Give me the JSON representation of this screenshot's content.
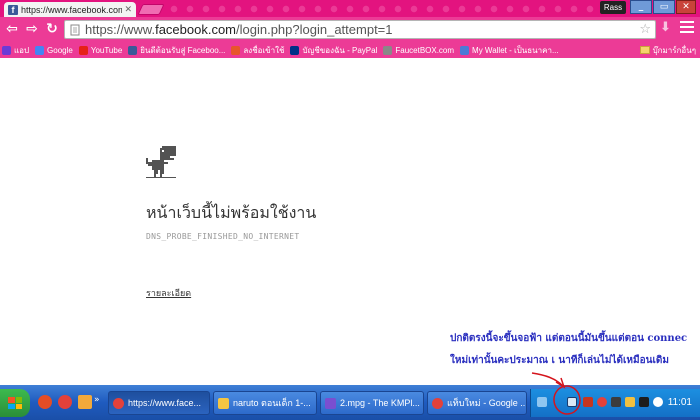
{
  "browser": {
    "tab_title": "https://www.facebook.com/",
    "tab_close": "✕",
    "profile_name": "Rass",
    "window_buttons": [
      "_",
      "▭",
      "✕"
    ],
    "nav": {
      "back": "⇦",
      "forward": "⇨",
      "reload": "↻"
    },
    "url_scheme": "https://www.",
    "url_host": "facebook.com",
    "url_path": "/login.php?login_attempt=1",
    "star": "☆",
    "extension": "⬇"
  },
  "bookmarks": {
    "items": [
      {
        "label": "แอป",
        "color": "#6b3bd6"
      },
      {
        "label": "Google",
        "color": "#4285f4"
      },
      {
        "label": "YouTube",
        "color": "#e62117"
      },
      {
        "label": "ยินดีต้อนรับสู่ Faceboo...",
        "color": "#3b5998"
      },
      {
        "label": "ลงชื่อเข้าใช้",
        "color": "#e8562a"
      },
      {
        "label": "บัญชีของฉัน - PayPal",
        "color": "#003087"
      },
      {
        "label": "FaucetBOX.com",
        "color": "#888888"
      },
      {
        "label": "My Wallet - เป็นธนาคา...",
        "color": "#4a7bd6"
      }
    ],
    "other": "บุ๊กมาร์กอื่นๆ"
  },
  "page": {
    "title": "หน้าเว็บนี้ไม่พร้อมใช้งาน",
    "error_code": "DNS_PROBE_FINISHED_NO_INTERNET",
    "details_link": "รายละเอียด",
    "annotation_line1": "ปกติตรงนี้จะขึ้นจอฟ้า แต่ตอนนี้มันขึ้นแต่ตอน connec",
    "annotation_line2": "ใหม่เท่านั้นคะประมาณ เ นาทีก็เล่นไม่ได้เหมือนเดิม",
    "annotation_color": "#2a2fbf"
  },
  "taskbar": {
    "tasks": [
      {
        "label": "https://www.face...",
        "color": "#e3413a",
        "active": true
      },
      {
        "label": "naruto ตอนเด็ก 1-...",
        "color": "#f5c542",
        "active": false
      },
      {
        "label": "2.mpg - The KMPl...",
        "color": "#7a4fd0",
        "active": false
      },
      {
        "label": "แท็บใหม่ - Google ...",
        "color": "#e3413a",
        "active": false
      }
    ],
    "clock": "11:01"
  }
}
